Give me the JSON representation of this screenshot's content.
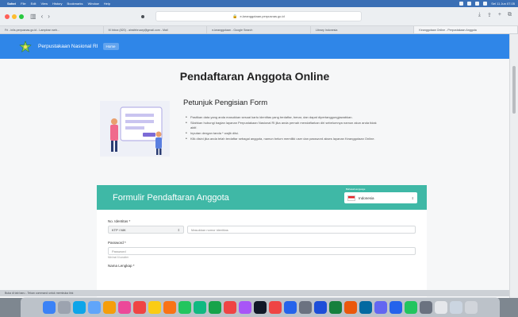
{
  "menubar": {
    "items": [
      "Safari",
      "File",
      "Edit",
      "View",
      "History",
      "Bookmarks",
      "Window",
      "Help"
    ],
    "clock": "Sel 11 Jun 07.05"
  },
  "browser": {
    "address": "e-keanggotaan.perpusnas.go.id",
    "tabs": [
      "Fri - inlis.perpusnas.go.id - Lampiran web...",
      "M Inbox (820) - ainsfebruary@gmail.com - Mail",
      "e-keanggotaan - Google Search",
      "Library Indonesia",
      "Keanggotaan Online - Perpustakaan Anggota"
    ],
    "active_tab": 4
  },
  "page": {
    "brand": "Perpustakaan Nasional RI",
    "nav_home": "Home",
    "title": "Pendaftaran Anggota Online",
    "guide_title": "Petunjuk Pengisian Form",
    "guide_items": [
      "Pastikan data yang anda masukkan sesuai kartu identitas yang terdaftar, benar, dan dapat dipertanggungjawabkan.",
      "Silahkan hubungi bagian layanan Perpustakaan Nasional RI jika anda pernah mendaftarkan diri sebelumnya namun akun anda tidak aktif.",
      "Inputan dengan tanda * wajib diisi.",
      "Klik disini jika anda telah terdaftar sebagai anggota, namun belum memiliki user dan password akses layanan Keanggotaan Online."
    ],
    "form_title": "Formulir Pendaftaran Anggota",
    "language_label": "Bahasa/Language",
    "language_value": "Indonesia",
    "id_label": "No. Identitas *",
    "id_type": "KTP / NIK",
    "id_placeholder": "Masukkan nomor identitas",
    "password_label": "Password *",
    "password_placeholder": "Password",
    "password_hint": "Minimal 6 karakter",
    "fullname_label": "Nama Lengkap *"
  },
  "statusbar": {
    "text": "Buka di tab baru - Tekan command untuk membuka link"
  },
  "colors": {
    "nav": "#2f86e8",
    "card_header": "#3fb8a6",
    "menubar": "#3a6fb5"
  },
  "dock": {
    "icons": [
      "finder-icon",
      "launchpad-icon",
      "safari-icon",
      "mail-icon",
      "chrome-icon",
      "photos-icon",
      "calendar-icon",
      "notes-icon",
      "reminders-icon",
      "maps-icon",
      "messages-icon",
      "facetime-icon",
      "music-icon",
      "podcasts-icon",
      "tv-icon",
      "news-icon",
      "appstore-icon",
      "settings-icon",
      "word-icon",
      "excel-icon",
      "powerpoint-icon",
      "outlook-icon",
      "teams-icon",
      "zoom-icon",
      "whatsapp-icon",
      "preview-icon",
      "textedit-icon",
      "downloads-icon",
      "trash-icon"
    ]
  }
}
